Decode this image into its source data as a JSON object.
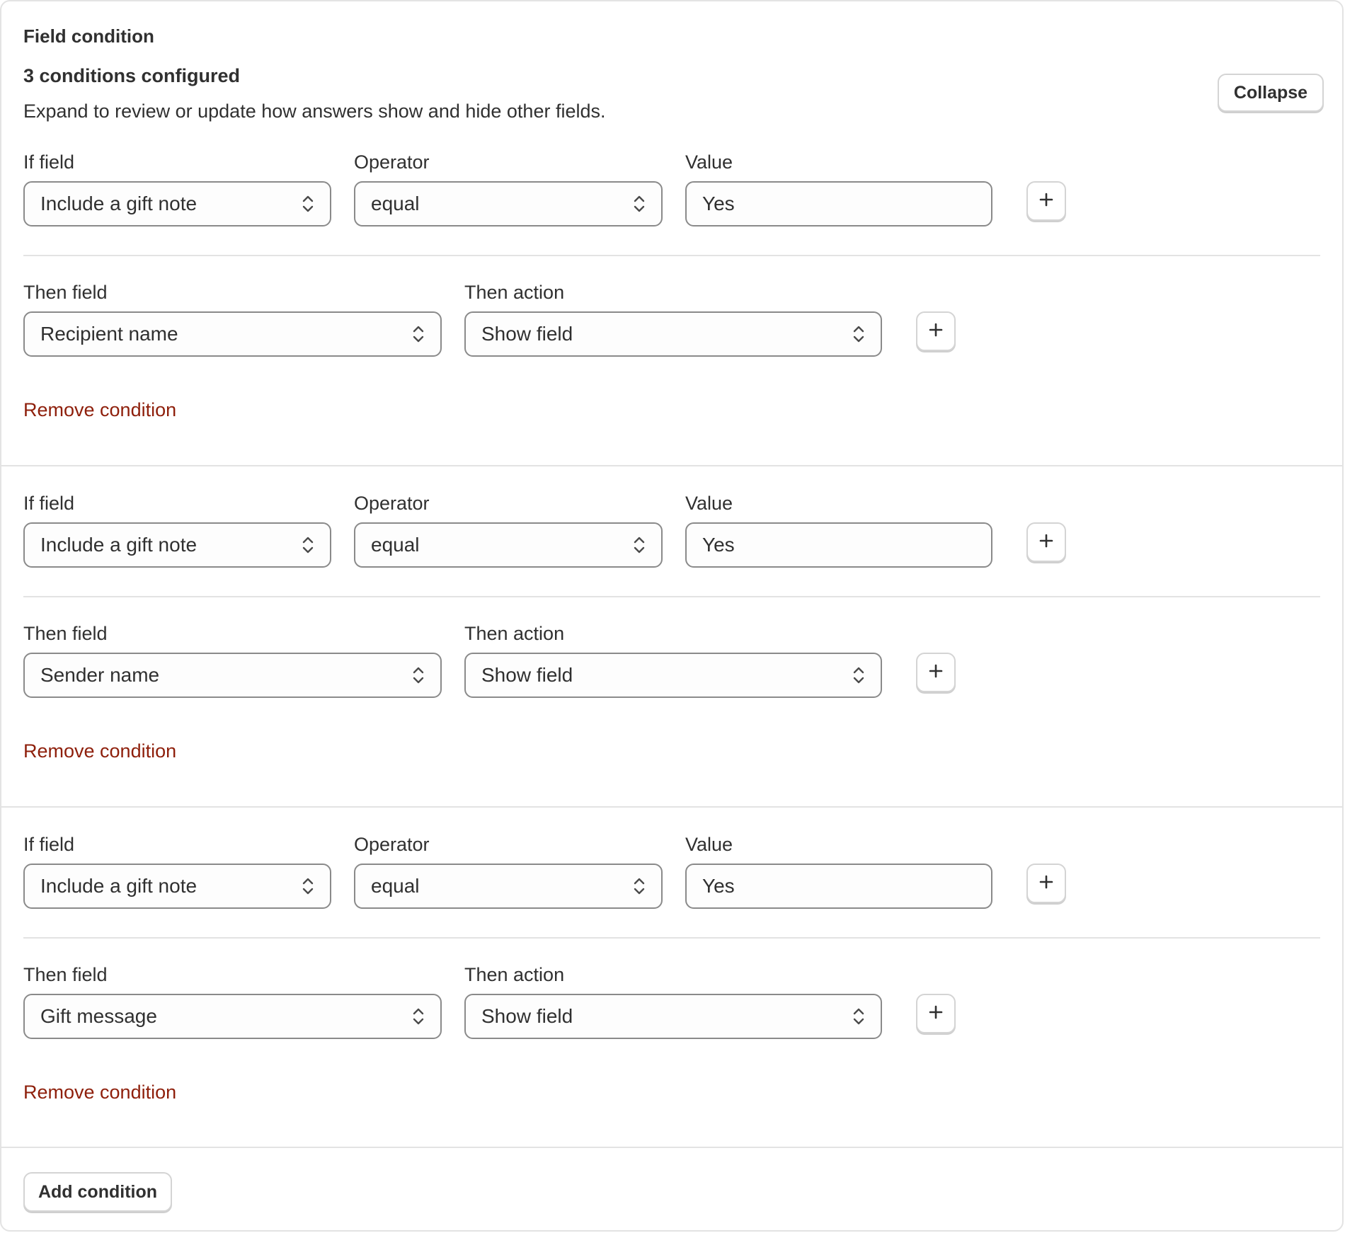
{
  "panel": {
    "title": "Field condition",
    "summary": "3 conditions configured",
    "description": "Expand to review or update how answers show and hide other fields.",
    "collapse_label": "Collapse",
    "add_condition_label": "Add condition"
  },
  "labels": {
    "if_field": "If field",
    "operator": "Operator",
    "value": "Value",
    "then_field": "Then field",
    "then_action": "Then action",
    "remove": "Remove condition"
  },
  "conditions": [
    {
      "if_field": "Include a gift note",
      "operator": "equal",
      "value": "Yes",
      "then_field": "Recipient name",
      "then_action": "Show field"
    },
    {
      "if_field": "Include a gift note",
      "operator": "equal",
      "value": "Yes",
      "then_field": "Sender name",
      "then_action": "Show field"
    },
    {
      "if_field": "Include a gift note",
      "operator": "equal",
      "value": "Yes",
      "then_field": "Gift message",
      "then_action": "Show field"
    }
  ],
  "icons": {
    "select": "chevron-up-down-icon",
    "add": "plus-icon"
  },
  "colors": {
    "remove_link": "#8e1f0b",
    "text": "#303030",
    "border": "#8a8a8a"
  }
}
